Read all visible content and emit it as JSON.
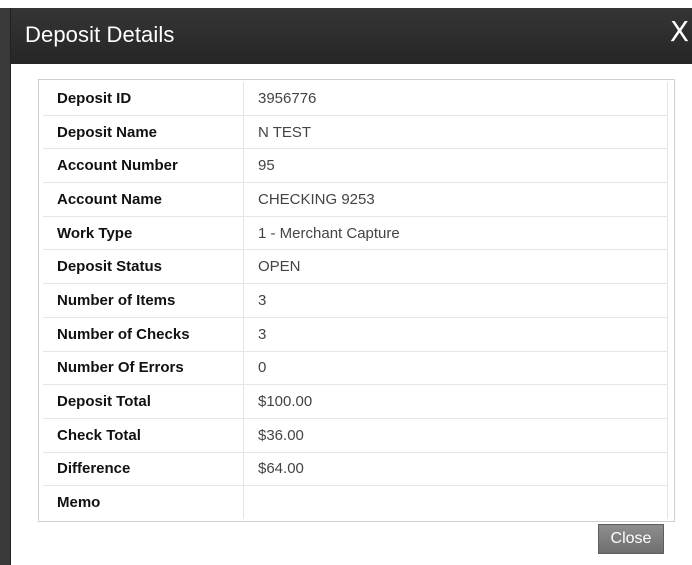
{
  "dialog": {
    "title": "Deposit Details",
    "close_icon": "X",
    "close_button_label": "Close"
  },
  "details": [
    {
      "label": "Deposit ID",
      "value": "3956776"
    },
    {
      "label": "Deposit Name",
      "value": "N TEST"
    },
    {
      "label": "Account Number",
      "value": "95"
    },
    {
      "label": "Account Name",
      "value": "CHECKING 9253"
    },
    {
      "label": "Work Type",
      "value": "1 - Merchant Capture"
    },
    {
      "label": "Deposit Status",
      "value": "OPEN"
    },
    {
      "label": "Number of Items",
      "value": "3"
    },
    {
      "label": "Number of Checks",
      "value": "3"
    },
    {
      "label": "Number Of Errors",
      "value": "0"
    },
    {
      "label": "Deposit Total",
      "value": "$100.00"
    },
    {
      "label": "Check Total",
      "value": "$36.00"
    },
    {
      "label": "Difference",
      "value": "$64.00"
    },
    {
      "label": "Memo",
      "value": ""
    }
  ],
  "colors": {
    "titlebar": "#2d2d2d",
    "button": "#7f7f7f"
  }
}
